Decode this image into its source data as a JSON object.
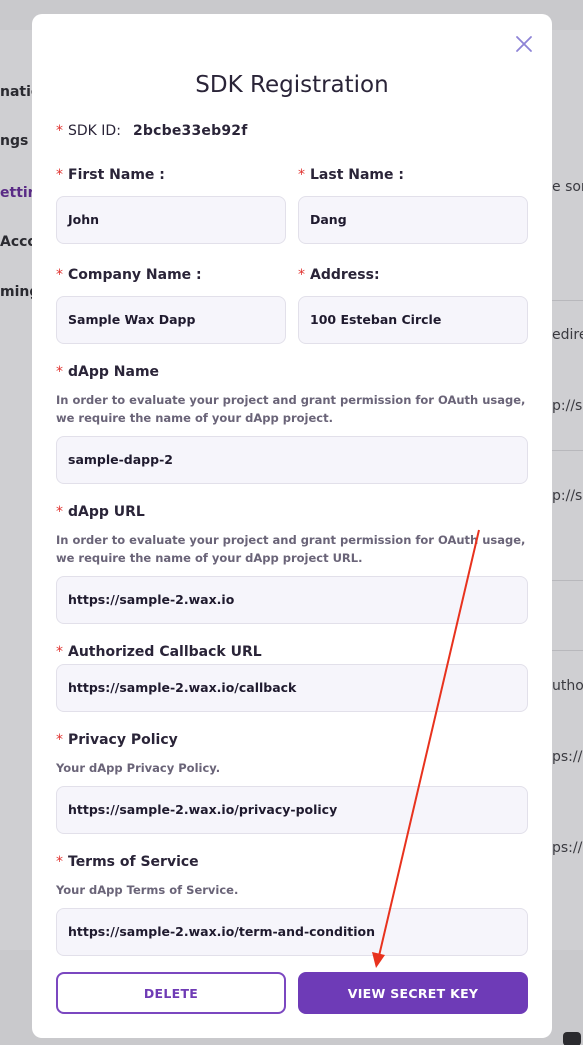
{
  "background": {
    "fragments": [
      "nation",
      "ngs &",
      "etting",
      "Acco",
      "ming",
      "e som",
      "edire",
      "p://s",
      "p://s",
      "uthor",
      "ps://",
      "ps://"
    ]
  },
  "modal": {
    "title": "SDK Registration",
    "close_icon": "close-icon",
    "sdk_id": {
      "label": "SDK ID:",
      "value": "2bcbe33eb92f"
    },
    "required_marker": "*",
    "fields": {
      "first_name": {
        "label": "First Name",
        "colon": ":",
        "value": "John"
      },
      "last_name": {
        "label": "Last Name",
        "colon": ":",
        "value": "Dang"
      },
      "company_name": {
        "label": "Company Name",
        "colon": ":",
        "value": "Sample Wax Dapp"
      },
      "address": {
        "label": "Address",
        "colon": ":",
        "value": "100 Esteban Circle"
      },
      "dapp_name": {
        "label": "dApp Name",
        "help": "In order to evaluate your project and grant permission for OAuth usage, we require the name of your dApp project.",
        "value": "sample-dapp-2"
      },
      "dapp_url": {
        "label": "dApp URL",
        "help": "In order to evaluate your project and grant permission for OAuth usage, we require the name of your dApp project URL.",
        "value": "https://sample-2.wax.io"
      },
      "callback_url": {
        "label": "Authorized Callback URL",
        "value": "https://sample-2.wax.io/callback"
      },
      "privacy_policy": {
        "label": "Privacy Policy",
        "help": "Your dApp Privacy Policy.",
        "value": "https://sample-2.wax.io/privacy-policy"
      },
      "terms": {
        "label": "Terms of Service",
        "help": "Your dApp Terms of Service.",
        "value": "https://sample-2.wax.io/term-and-condition"
      }
    },
    "buttons": {
      "delete": "DELETE",
      "view_secret": "VIEW SECRET KEY"
    }
  },
  "colors": {
    "accent": "#6e3bb7",
    "required": "#e0322f",
    "annotation_arrow": "#e8321e"
  }
}
